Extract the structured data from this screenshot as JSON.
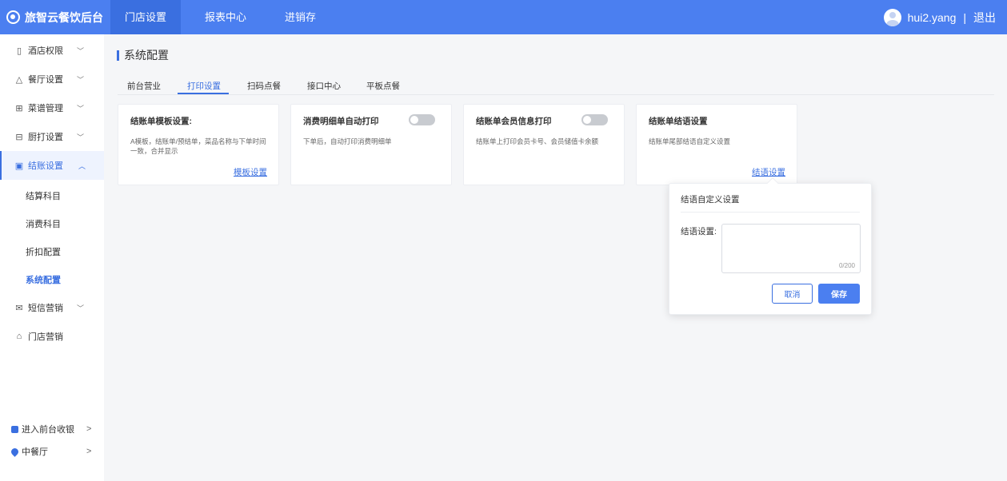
{
  "brand": {
    "name": "旅智云餐饮后台",
    "icon": "brand-logo-icon"
  },
  "topnav": {
    "items": [
      {
        "label": "门店设置",
        "active": true
      },
      {
        "label": "报表中心",
        "active": false
      },
      {
        "label": "进销存",
        "active": false
      }
    ]
  },
  "user": {
    "name": "hui2.yang",
    "separator": "|",
    "logout": "退出"
  },
  "sidebar": {
    "items": [
      {
        "label": "酒店权限",
        "icon": "hotel-icon",
        "glyph": "▯"
      },
      {
        "label": "餐厅设置",
        "icon": "restaurant-icon",
        "glyph": "△"
      },
      {
        "label": "菜谱管理",
        "icon": "menu-grid-icon",
        "glyph": "⊞"
      },
      {
        "label": "厨打设置",
        "icon": "kitchen-print-icon",
        "glyph": "⊟"
      },
      {
        "label": "结账设置",
        "icon": "checkout-icon",
        "glyph": "▣"
      }
    ],
    "sub_items": [
      {
        "label": "结算科目"
      },
      {
        "label": "消费科目"
      },
      {
        "label": "折扣配置"
      },
      {
        "label": "系统配置"
      }
    ],
    "after_items": [
      {
        "label": "短信营销",
        "icon": "mail-icon",
        "glyph": "✉"
      },
      {
        "label": "门店营销",
        "icon": "store-icon",
        "glyph": "⌂"
      }
    ],
    "bottom": [
      {
        "label": "进入前台收银",
        "icon": "cashier-icon"
      },
      {
        "label": "中餐厅",
        "icon": "location-pin-icon"
      }
    ]
  },
  "page": {
    "title": "系统配置"
  },
  "tabs": [
    {
      "label": "前台营业"
    },
    {
      "label": "打印设置"
    },
    {
      "label": "扫码点餐"
    },
    {
      "label": "接口中心"
    },
    {
      "label": "平板点餐"
    }
  ],
  "cards": [
    {
      "title": "结账单模板设置:",
      "desc": "A模板，结账单/预结单，菜品名称与下单时间一致，合并显示",
      "link": "模板设置"
    },
    {
      "title": "消费明细单自动打印",
      "desc": "下单后，自动打印消费明细单",
      "toggle": "off"
    },
    {
      "title": "结账单会员信息打印",
      "desc": "结账单上打印会员卡号、会员储值卡余额",
      "toggle": "off"
    },
    {
      "title": "结账单结语设置",
      "desc": "结账单尾部结语自定义设置",
      "link": "结语设置"
    }
  ],
  "popover": {
    "title": "结语自定义设置",
    "label": "结语设置:",
    "textarea_value": "",
    "counter": "0/200",
    "cancel": "取消",
    "save": "保存"
  },
  "colors": {
    "primary": "#4b7ff0",
    "active": "#3a6fe0"
  }
}
